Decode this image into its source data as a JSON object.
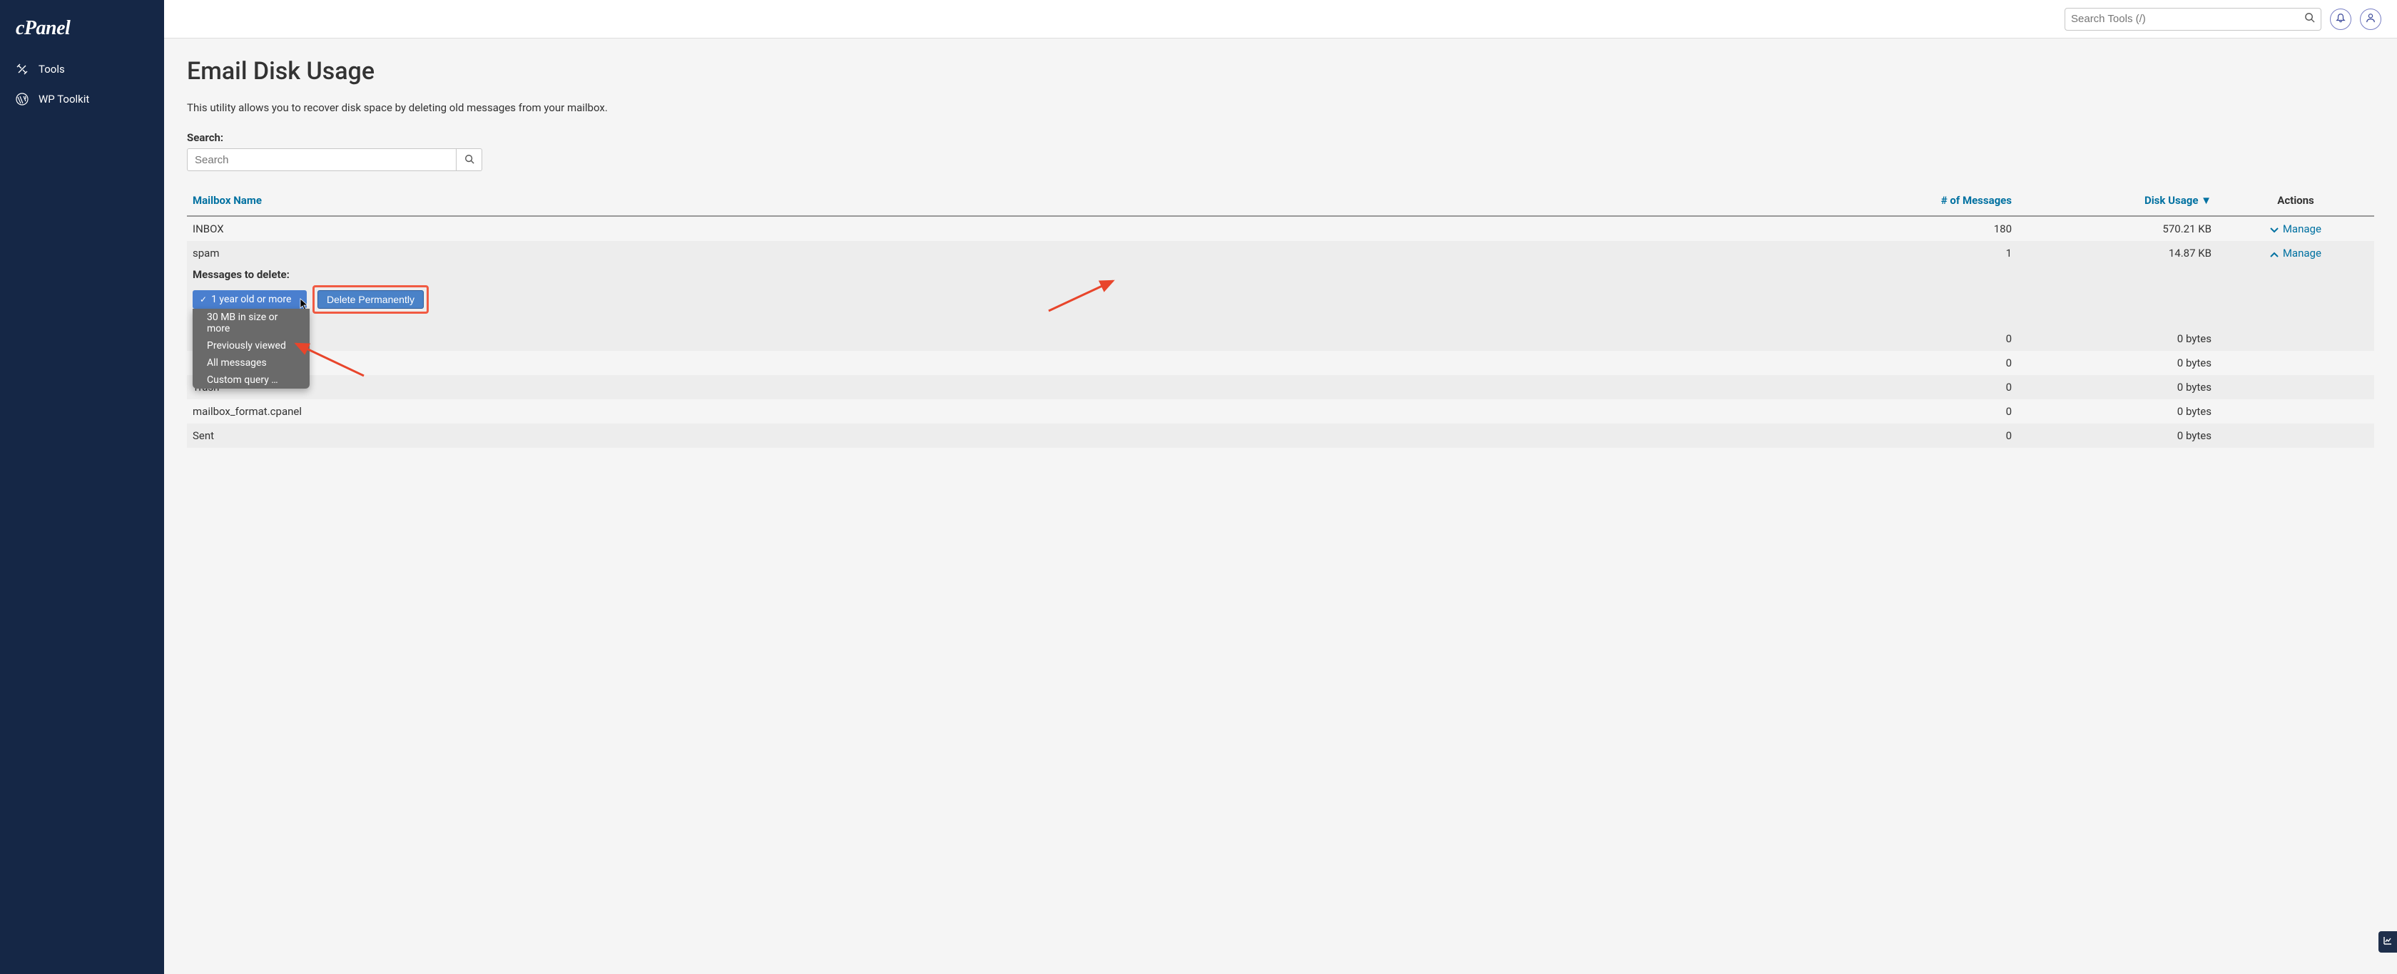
{
  "brand": "cPanel",
  "sidebar": {
    "items": [
      {
        "label": "Tools"
      },
      {
        "label": "WP Toolkit"
      }
    ]
  },
  "topbar": {
    "search_placeholder": "Search Tools (/)"
  },
  "page": {
    "title": "Email Disk Usage",
    "description": "This utility allows you to recover disk space by deleting old messages from your mailbox.",
    "search_label": "Search:",
    "search_placeholder": "Search"
  },
  "table": {
    "headers": {
      "name": "Mailbox Name",
      "msgs": "# of Messages",
      "disk": "Disk Usage ▼",
      "actions": "Actions"
    },
    "manage_label": "Manage",
    "rows": [
      {
        "name": "INBOX",
        "msgs": "180",
        "disk": "570.21 KB",
        "expanded": false
      },
      {
        "name": "spam",
        "msgs": "1",
        "disk": "14.87 KB",
        "expanded": true
      },
      {
        "name": "",
        "msgs": "0",
        "disk": "0 bytes",
        "expanded": false
      },
      {
        "name": "",
        "msgs": "0",
        "disk": "0 bytes",
        "expanded": false
      },
      {
        "name": "Trash",
        "msgs": "0",
        "disk": "0 bytes",
        "expanded": false
      },
      {
        "name": "mailbox_format.cpanel",
        "msgs": "0",
        "disk": "0 bytes",
        "expanded": false
      },
      {
        "name": "Sent",
        "msgs": "0",
        "disk": "0 bytes",
        "expanded": false
      }
    ]
  },
  "manage_panel": {
    "label": "Messages to delete:",
    "selected": "1 year old or more",
    "options": [
      "30 MB in size or more",
      "Previously viewed",
      "All messages",
      "Custom query …"
    ],
    "delete_btn": "Delete Permanently"
  },
  "chart_data": {
    "type": "table",
    "title": "Email Disk Usage",
    "columns": [
      "Mailbox Name",
      "# of Messages",
      "Disk Usage"
    ],
    "rows": [
      [
        "INBOX",
        180,
        "570.21 KB"
      ],
      [
        "spam",
        1,
        "14.87 KB"
      ],
      [
        "",
        0,
        "0 bytes"
      ],
      [
        "",
        0,
        "0 bytes"
      ],
      [
        "Trash",
        0,
        "0 bytes"
      ],
      [
        "mailbox_format.cpanel",
        0,
        "0 bytes"
      ],
      [
        "Sent",
        0,
        "0 bytes"
      ]
    ]
  }
}
